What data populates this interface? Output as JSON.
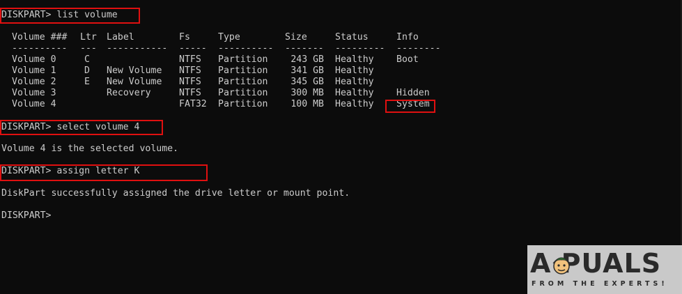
{
  "console": {
    "cmd1": "DISKPART> list volume",
    "table": {
      "headers": [
        "Volume ###",
        "Ltr",
        "Label",
        "Fs",
        "Type",
        "Size",
        "Status",
        "Info"
      ],
      "separators": [
        "----------",
        "---",
        "-----------",
        "-----",
        "----------",
        "-------",
        "---------",
        "--------"
      ],
      "rows": [
        [
          "Volume 0",
          "C",
          "",
          "NTFS",
          "Partition",
          "243 GB",
          "Healthy",
          "Boot"
        ],
        [
          "Volume 1",
          "D",
          "New Volume",
          "NTFS",
          "Partition",
          "341 GB",
          "Healthy",
          ""
        ],
        [
          "Volume 2",
          "E",
          "New Volume",
          "NTFS",
          "Partition",
          "345 GB",
          "Healthy",
          ""
        ],
        [
          "Volume 3",
          "",
          "Recovery",
          "NTFS",
          "Partition",
          "300 MB",
          "Healthy",
          "Hidden"
        ],
        [
          "Volume 4",
          "",
          "",
          "FAT32",
          "Partition",
          "100 MB",
          "Healthy",
          "System"
        ]
      ]
    },
    "cmd2": "DISKPART> select volume 4",
    "out2": "Volume 4 is the selected volume.",
    "cmd3": "DISKPART> assign letter K",
    "out3": "DiskPart successfully assigned the drive letter or mount point.",
    "prompt": "DISKPART>"
  },
  "watermark": {
    "logo": "A PUALS",
    "tagline": "FROM THE EXPERTS!"
  },
  "colors": {
    "background": "#0c0c0c",
    "text": "#cccccc",
    "highlight": "#e01010"
  }
}
